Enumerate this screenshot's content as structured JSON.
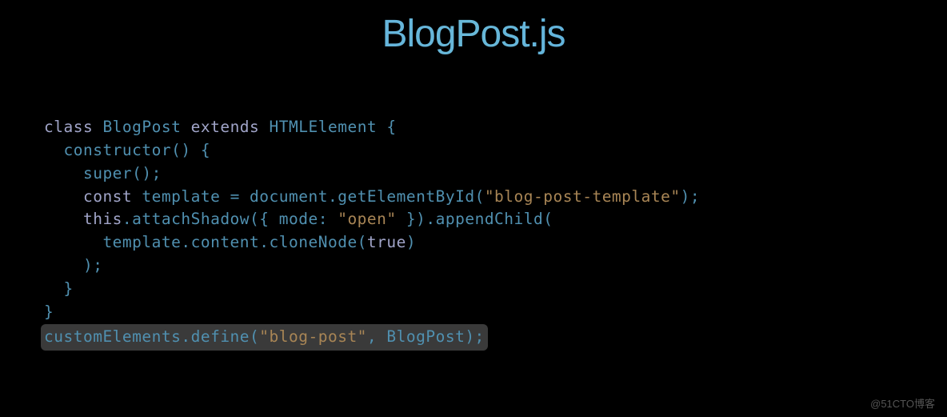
{
  "title": "BlogPost.js",
  "code": {
    "line1": {
      "kw1": "class",
      "name1": " BlogPost ",
      "kw2": "extends",
      "name2": " HTMLElement {"
    },
    "line2": "  constructor() {",
    "line3": "    super();",
    "line4": {
      "kw1": "    const",
      "text1": " template = document.getElementById(",
      "str1": "\"blog-post-template\"",
      "text2": ");"
    },
    "line5": {
      "kw1": "    this",
      "text1": ".attachShadow({ mode: ",
      "str1": "\"open\"",
      "text2": " }).appendChild("
    },
    "line6": {
      "text1": "      template.content.cloneNode(",
      "kw1": "true",
      "text2": ")"
    },
    "line7": "    );",
    "line8": "  }",
    "line9": "}",
    "line10": {
      "text1": "customElements.define(",
      "str1": "\"blog-post\"",
      "text2": ", BlogPost);"
    }
  },
  "watermark": "@51CTO博客"
}
